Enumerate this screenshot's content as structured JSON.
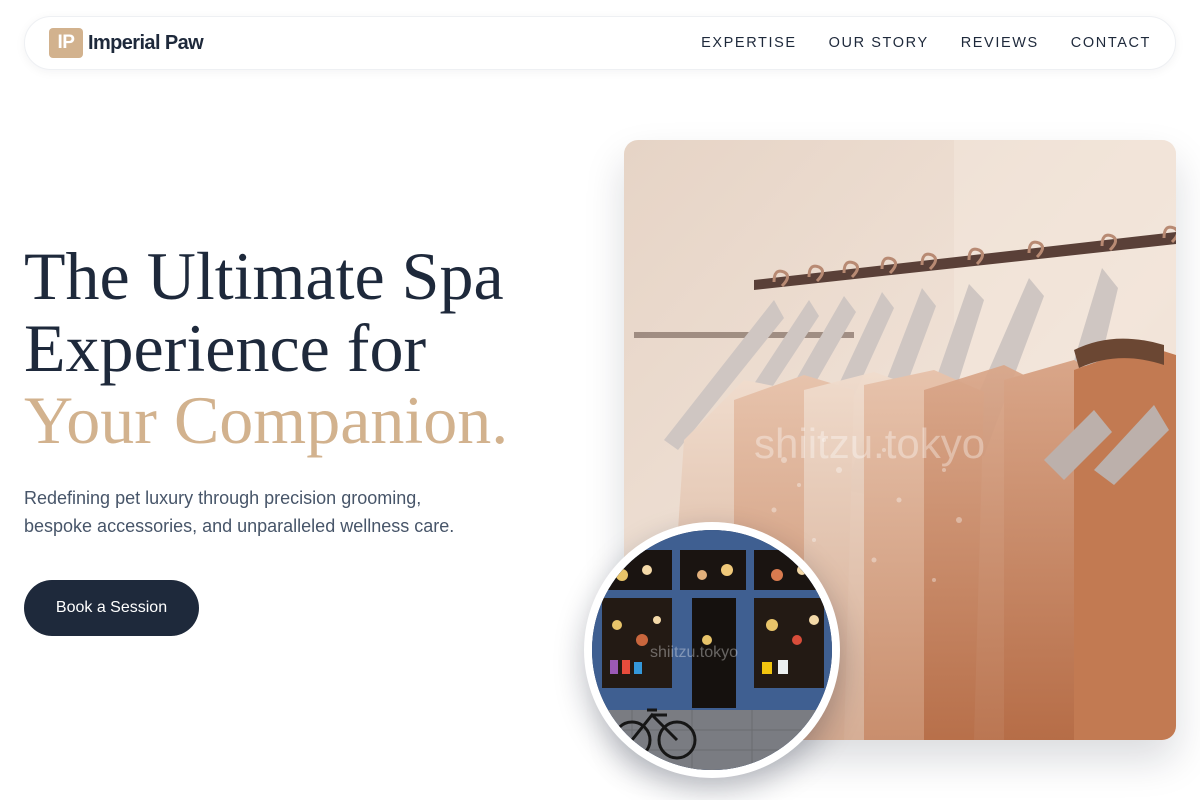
{
  "brand": {
    "logo_text": "IP",
    "name": "Imperial Paw",
    "accent_color": "#d2b28e",
    "dark_color": "#1e293b"
  },
  "nav": {
    "items": [
      {
        "label": "EXPERTISE"
      },
      {
        "label": "OUR STORY"
      },
      {
        "label": "REVIEWS"
      },
      {
        "label": "CONTACT"
      }
    ]
  },
  "hero": {
    "headline_line1": "The Ultimate Spa",
    "headline_line2": "Experience for",
    "headline_accent": "Your Companion.",
    "subtext_line1": "Redefining pet luxury through precision grooming,",
    "subtext_line2": "bespoke accessories, and unparalleled wellness care.",
    "cta_label": "Book a Session"
  },
  "images": {
    "main_watermark": "shiitzu.tokyo",
    "inset_watermark": "shiitzu.tokyo"
  }
}
